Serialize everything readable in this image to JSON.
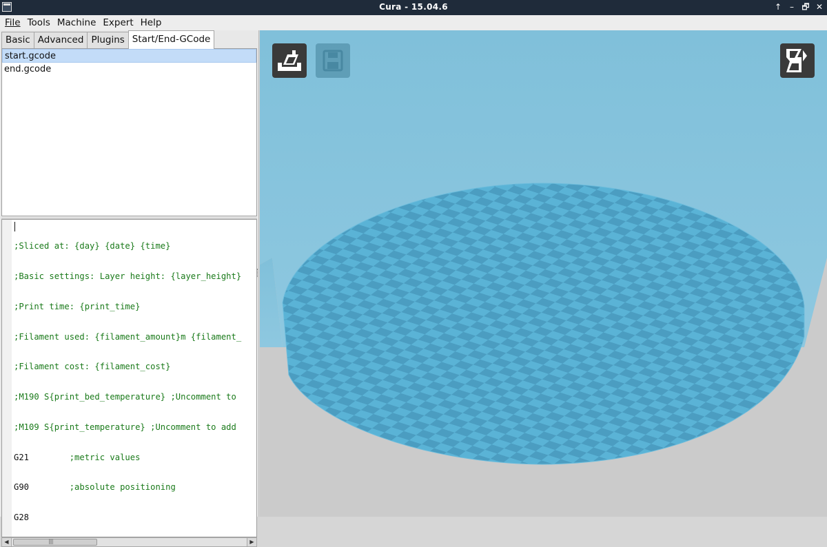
{
  "window": {
    "title": "Cura - 15.04.6",
    "controls": [
      "↑",
      "–",
      "🗗",
      "✕"
    ]
  },
  "menu": [
    "File",
    "Tools",
    "Machine",
    "Expert",
    "Help"
  ],
  "tabs": [
    {
      "label": "Basic",
      "active": false
    },
    {
      "label": "Advanced",
      "active": false
    },
    {
      "label": "Plugins",
      "active": false
    },
    {
      "label": "Start/End-GCode",
      "active": true
    }
  ],
  "files": [
    {
      "name": "start.gcode",
      "selected": true
    },
    {
      "name": "end.gcode",
      "selected": false
    }
  ],
  "code_lines": [
    ";Sliced at: {day} {date} {time}",
    ";Basic settings: Layer height: {layer_height}",
    ";Print time: {print_time}",
    ";Filament used: {filament_amount}m {filament_",
    ";Filament cost: {filament_cost}",
    ";M190 S{print_bed_temperature} ;Uncomment to",
    ";M109 S{print_temperature} ;Uncomment to add",
    "G21        ;metric values",
    "G90        ;absolute positioning",
    "G28"
  ],
  "toolbar": {
    "load_icon": "load-model-icon",
    "save_icon": "save-gcode-icon",
    "view_icon": "view-mode-icon"
  },
  "colors": {
    "sky": "#7fbfd9",
    "floor": "#cfcfcf",
    "bed_light": "#5ab3d6",
    "bed_dark": "#4a9cc0"
  }
}
